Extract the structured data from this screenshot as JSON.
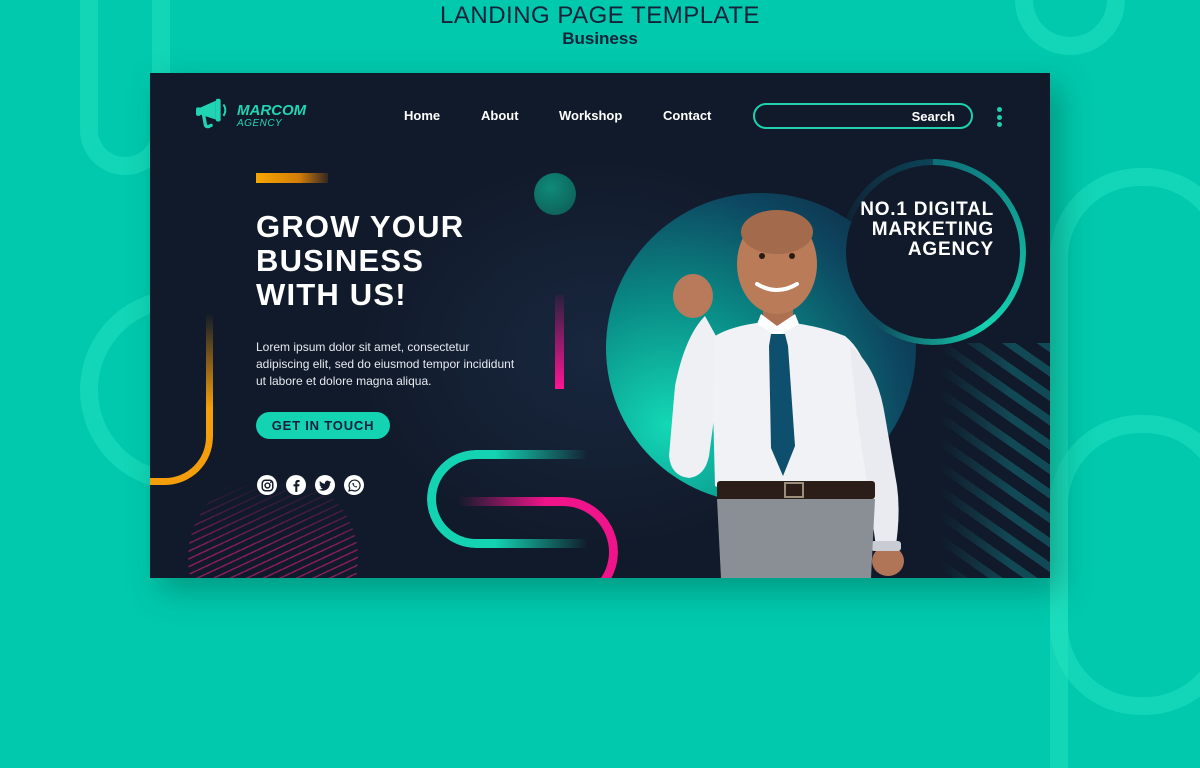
{
  "page": {
    "title": "LANDING PAGE TEMPLATE",
    "subtitle": "Business"
  },
  "header": {
    "logo": {
      "icon": "megaphone-icon",
      "name": "MARCOM",
      "tagline": "AGENCY"
    },
    "nav": [
      {
        "label": "Home"
      },
      {
        "label": "About"
      },
      {
        "label": "Workshop"
      },
      {
        "label": "Contact"
      }
    ],
    "search": {
      "button_label": "Search",
      "value": "",
      "placeholder": ""
    },
    "menu_icon": "kebab-menu-icon"
  },
  "hero": {
    "headline_lines": [
      "GROW YOUR",
      "BUSINESS",
      "WITH US!"
    ],
    "body": "Lorem ipsum dolor sit amet, consectetur adipiscing elit, sed do eiusmod tempor incididunt ut labore et dolore magna aliqua.",
    "cta_label": "GET IN TOUCH",
    "socials": [
      {
        "icon": "instagram-icon"
      },
      {
        "icon": "facebook-icon"
      },
      {
        "icon": "twitter-icon"
      },
      {
        "icon": "whatsapp-icon"
      }
    ],
    "tagline_lines": [
      "NO.1 DIGITAL",
      "MARKETING",
      "AGENCY"
    ],
    "image": "smiling-businessman-fist-pump"
  },
  "colors": {
    "background": "#00c9ad",
    "card": "#111a2a",
    "accent_teal": "#13d3b2",
    "accent_orange": "#f49e0b",
    "accent_pink": "#f0148a",
    "text_dark": "#15223a"
  }
}
